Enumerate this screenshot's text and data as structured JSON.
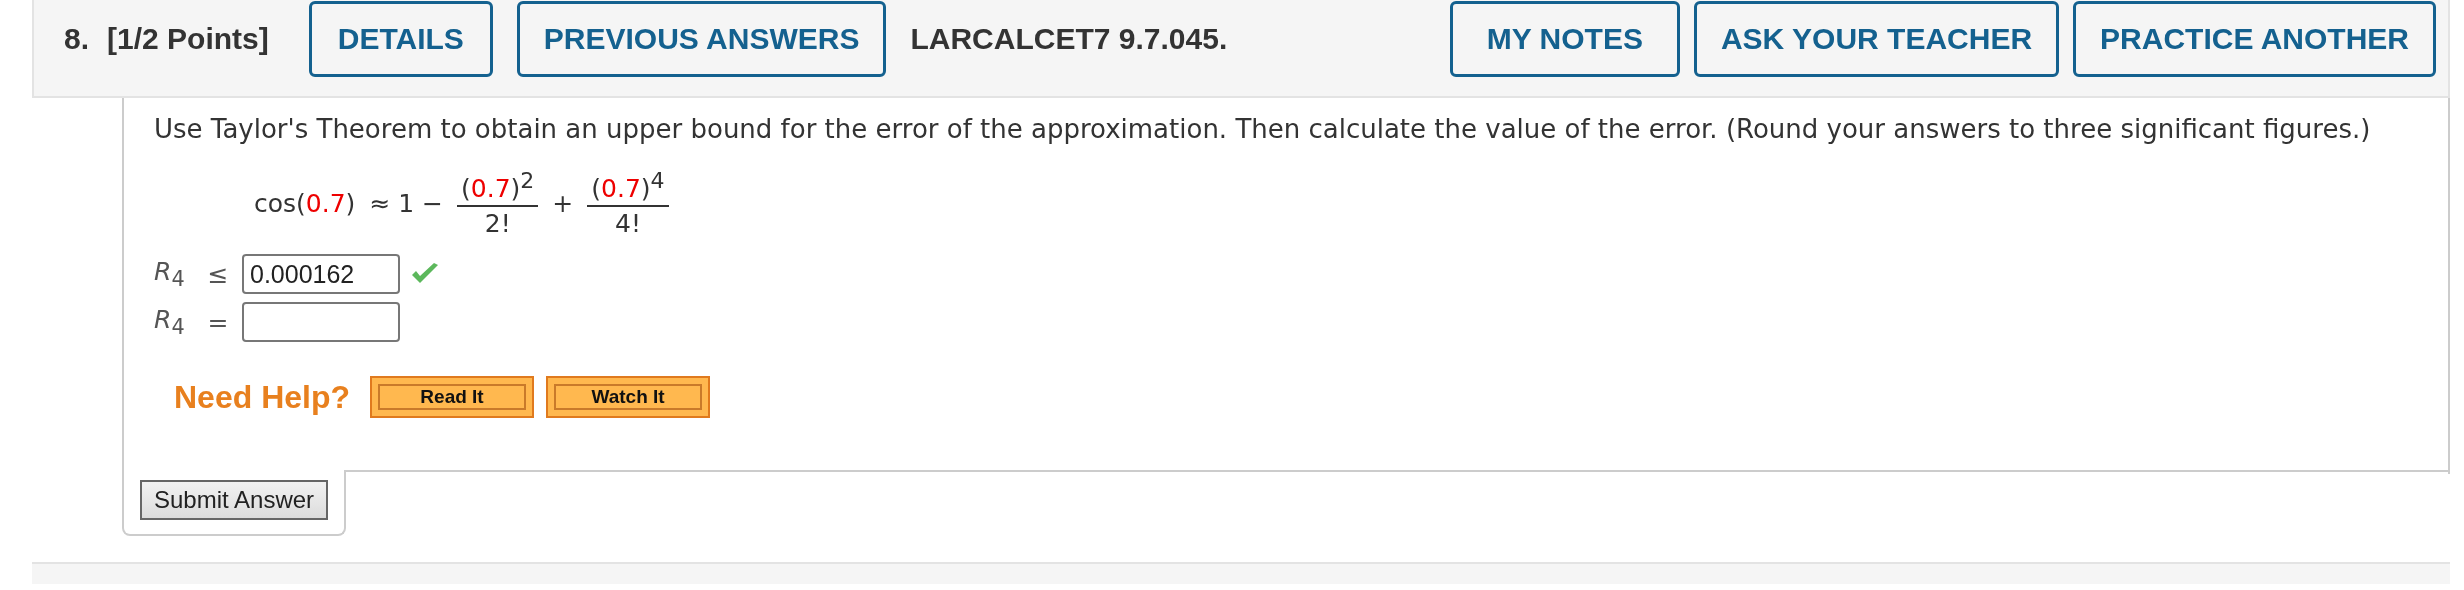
{
  "header": {
    "number": "8.",
    "points": "[1/2 Points]",
    "buttons_left": [
      "DETAILS",
      "PREVIOUS ANSWERS"
    ],
    "code": "LARCALCET7 9.7.045.",
    "buttons_right": [
      "MY NOTES",
      "ASK YOUR TEACHER",
      "PRACTICE ANOTHER"
    ]
  },
  "prompt": "Use Taylor's Theorem to obtain an upper bound for the error of the approximation. Then calculate the value of the error. (Round your answers to three significant figures.)",
  "formula": {
    "lhs": [
      {
        "text": "cos(",
        "highlighted": false
      },
      {
        "text": "0.7",
        "highlighted": true
      },
      {
        "text": ")",
        "highlighted": false
      }
    ],
    "relation": "≈ 1 −",
    "terms": [
      {
        "num": [
          {
            "text": "(",
            "highlighted": false
          },
          {
            "text": "0.7",
            "highlighted": true
          },
          {
            "text": ")",
            "highlighted": false
          }
        ],
        "exp": "2",
        "den": "2!"
      },
      {
        "op": "+",
        "num": [
          {
            "text": "(",
            "highlighted": false
          },
          {
            "text": "0.7",
            "highlighted": true
          },
          {
            "text": ")",
            "highlighted": false
          }
        ],
        "exp": "4",
        "den": "4!"
      }
    ]
  },
  "answers": [
    {
      "label": "*R*$_{4}$",
      "relation": "≤",
      "value": "0.000162",
      "correct": true
    },
    {
      "label": "*R*$_{4}$",
      "relation": "=",
      "correct": false
    }
  ],
  "help": {
    "label": "Need Help?",
    "buttons": [
      "Read It",
      "Watch It"
    ]
  },
  "submit": "Submit Answer"
}
